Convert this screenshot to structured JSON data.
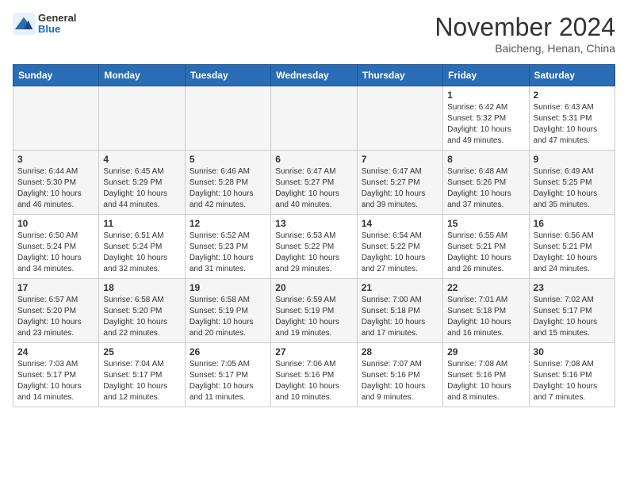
{
  "header": {
    "logo": {
      "general": "General",
      "blue": "Blue"
    },
    "title": "November 2024",
    "subtitle": "Baicheng, Henan, China"
  },
  "weekdays": [
    "Sunday",
    "Monday",
    "Tuesday",
    "Wednesday",
    "Thursday",
    "Friday",
    "Saturday"
  ],
  "weeks": [
    [
      {
        "day": "",
        "info": ""
      },
      {
        "day": "",
        "info": ""
      },
      {
        "day": "",
        "info": ""
      },
      {
        "day": "",
        "info": ""
      },
      {
        "day": "",
        "info": ""
      },
      {
        "day": "1",
        "info": "Sunrise: 6:42 AM\nSunset: 5:32 PM\nDaylight: 10 hours\nand 49 minutes."
      },
      {
        "day": "2",
        "info": "Sunrise: 6:43 AM\nSunset: 5:31 PM\nDaylight: 10 hours\nand 47 minutes."
      }
    ],
    [
      {
        "day": "3",
        "info": "Sunrise: 6:44 AM\nSunset: 5:30 PM\nDaylight: 10 hours\nand 46 minutes."
      },
      {
        "day": "4",
        "info": "Sunrise: 6:45 AM\nSunset: 5:29 PM\nDaylight: 10 hours\nand 44 minutes."
      },
      {
        "day": "5",
        "info": "Sunrise: 6:46 AM\nSunset: 5:28 PM\nDaylight: 10 hours\nand 42 minutes."
      },
      {
        "day": "6",
        "info": "Sunrise: 6:47 AM\nSunset: 5:27 PM\nDaylight: 10 hours\nand 40 minutes."
      },
      {
        "day": "7",
        "info": "Sunrise: 6:47 AM\nSunset: 5:27 PM\nDaylight: 10 hours\nand 39 minutes."
      },
      {
        "day": "8",
        "info": "Sunrise: 6:48 AM\nSunset: 5:26 PM\nDaylight: 10 hours\nand 37 minutes."
      },
      {
        "day": "9",
        "info": "Sunrise: 6:49 AM\nSunset: 5:25 PM\nDaylight: 10 hours\nand 35 minutes."
      }
    ],
    [
      {
        "day": "10",
        "info": "Sunrise: 6:50 AM\nSunset: 5:24 PM\nDaylight: 10 hours\nand 34 minutes."
      },
      {
        "day": "11",
        "info": "Sunrise: 6:51 AM\nSunset: 5:24 PM\nDaylight: 10 hours\nand 32 minutes."
      },
      {
        "day": "12",
        "info": "Sunrise: 6:52 AM\nSunset: 5:23 PM\nDaylight: 10 hours\nand 31 minutes."
      },
      {
        "day": "13",
        "info": "Sunrise: 6:53 AM\nSunset: 5:22 PM\nDaylight: 10 hours\nand 29 minutes."
      },
      {
        "day": "14",
        "info": "Sunrise: 6:54 AM\nSunset: 5:22 PM\nDaylight: 10 hours\nand 27 minutes."
      },
      {
        "day": "15",
        "info": "Sunrise: 6:55 AM\nSunset: 5:21 PM\nDaylight: 10 hours\nand 26 minutes."
      },
      {
        "day": "16",
        "info": "Sunrise: 6:56 AM\nSunset: 5:21 PM\nDaylight: 10 hours\nand 24 minutes."
      }
    ],
    [
      {
        "day": "17",
        "info": "Sunrise: 6:57 AM\nSunset: 5:20 PM\nDaylight: 10 hours\nand 23 minutes."
      },
      {
        "day": "18",
        "info": "Sunrise: 6:58 AM\nSunset: 5:20 PM\nDaylight: 10 hours\nand 22 minutes."
      },
      {
        "day": "19",
        "info": "Sunrise: 6:58 AM\nSunset: 5:19 PM\nDaylight: 10 hours\nand 20 minutes."
      },
      {
        "day": "20",
        "info": "Sunrise: 6:59 AM\nSunset: 5:19 PM\nDaylight: 10 hours\nand 19 minutes."
      },
      {
        "day": "21",
        "info": "Sunrise: 7:00 AM\nSunset: 5:18 PM\nDaylight: 10 hours\nand 17 minutes."
      },
      {
        "day": "22",
        "info": "Sunrise: 7:01 AM\nSunset: 5:18 PM\nDaylight: 10 hours\nand 16 minutes."
      },
      {
        "day": "23",
        "info": "Sunrise: 7:02 AM\nSunset: 5:17 PM\nDaylight: 10 hours\nand 15 minutes."
      }
    ],
    [
      {
        "day": "24",
        "info": "Sunrise: 7:03 AM\nSunset: 5:17 PM\nDaylight: 10 hours\nand 14 minutes."
      },
      {
        "day": "25",
        "info": "Sunrise: 7:04 AM\nSunset: 5:17 PM\nDaylight: 10 hours\nand 12 minutes."
      },
      {
        "day": "26",
        "info": "Sunrise: 7:05 AM\nSunset: 5:17 PM\nDaylight: 10 hours\nand 11 minutes."
      },
      {
        "day": "27",
        "info": "Sunrise: 7:06 AM\nSunset: 5:16 PM\nDaylight: 10 hours\nand 10 minutes."
      },
      {
        "day": "28",
        "info": "Sunrise: 7:07 AM\nSunset: 5:16 PM\nDaylight: 10 hours\nand 9 minutes."
      },
      {
        "day": "29",
        "info": "Sunrise: 7:08 AM\nSunset: 5:16 PM\nDaylight: 10 hours\nand 8 minutes."
      },
      {
        "day": "30",
        "info": "Sunrise: 7:08 AM\nSunset: 5:16 PM\nDaylight: 10 hours\nand 7 minutes."
      }
    ]
  ]
}
